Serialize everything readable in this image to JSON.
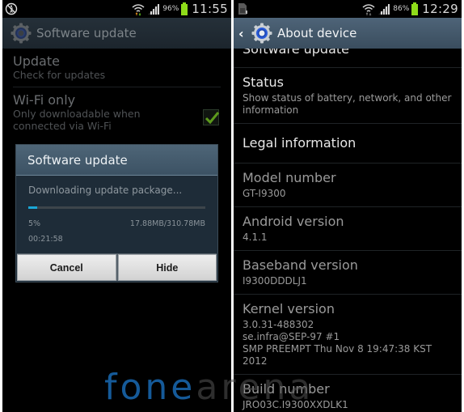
{
  "left_screen": {
    "statusbar": {
      "left_icon": "accessibility-blocked-icon",
      "wifi_icon": "wifi-icon",
      "signal_icon": "signal-icon",
      "battery_percent": "96%",
      "time": "11:55"
    },
    "actionbar": {
      "icon": "settings-gear-icon",
      "title": "Software update"
    },
    "settings": [
      {
        "title": "Update",
        "subtitle": "Check for updates"
      },
      {
        "title": "Wi-Fi only",
        "subtitle": "Only downloadable when connected via Wi-Fi",
        "checked": true
      }
    ],
    "dialog": {
      "title": "Software update",
      "message": "Downloading update package...",
      "progress_percent": 5,
      "percent_label": "5%",
      "size_label": "17.88MB/310.78MB",
      "time_remaining": "00:21:58",
      "buttons": {
        "cancel": "Cancel",
        "hide": "Hide"
      }
    }
  },
  "right_screen": {
    "statusbar": {
      "left_icon": "sim-card-icon",
      "wifi_icon": "wifi-icon",
      "signal_icon": "signal-icon",
      "battery_percent": "86%",
      "time": "12:29"
    },
    "actionbar": {
      "back_icon": "back-chevron-icon",
      "icon": "settings-gear-icon",
      "title": "About device"
    },
    "cut_item": "Software update",
    "items": [
      {
        "title": "Status",
        "subtitle": "Show status of battery, network, and other information"
      },
      {
        "title": "Legal information"
      },
      {
        "title": "Model number",
        "subtitle": "GT-I9300"
      },
      {
        "title": "Android version",
        "subtitle": "4.1.1"
      },
      {
        "title": "Baseband version",
        "subtitle": "I9300DDDLJ1"
      },
      {
        "title": "Kernel version",
        "subtitle_lines": [
          "3.0.31-488302",
          "se.infra@SEP-97 #1",
          "SMP PREEMPT Thu Nov 8 19:47:38 KST",
          "2012"
        ]
      },
      {
        "title": "Build number",
        "subtitle": "JRO03C.I9300XXDLK1"
      }
    ]
  },
  "watermark": {
    "part1": "fone",
    "part2": "arena"
  },
  "colors": {
    "progress": "#1aa7d6",
    "battery": "#8fdc1a",
    "checkmark": "#5c9a1c",
    "watermark_blue": "#155a99"
  }
}
